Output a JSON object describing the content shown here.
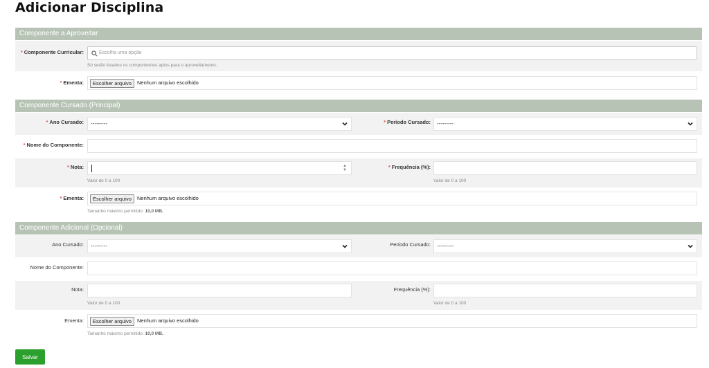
{
  "page": {
    "title": "Adicionar Disciplina",
    "save_label": "Salvar"
  },
  "colors": {
    "section_header": "#b7c4b5",
    "required": "#d9534f",
    "save_button": "#2ca02c"
  },
  "section1": {
    "title": "Componente a Aproveitar",
    "componente_label": "Componente Curricular:",
    "componente_placeholder": "Escolha uma opção",
    "componente_help": "Só serão listados os compontentes aptos para o aproveitamento.",
    "ementa_label": "Ementa:",
    "file_button": "Escolher arquivo",
    "file_status": "Nenhum arquivo escolhido"
  },
  "section2": {
    "title": "Componente Cursado (Principal)",
    "ano_label": "Ano Cursado:",
    "ano_value": "---------",
    "periodo_label": "Período Cursado:",
    "periodo_value": "---------",
    "nome_label": "Nome do Componente:",
    "nota_label": "Nota:",
    "nota_help": "Valor de 0 a 100",
    "freq_label": "Frequência (%):",
    "freq_help": "Valor de 0 a 100",
    "ementa_label": "Ementa:",
    "file_button": "Escolher arquivo",
    "file_status": "Nenhum arquivo escolhido",
    "size_help_prefix": "Tamanho máximo permitido:",
    "size_help_value": "10,0 MB."
  },
  "section3": {
    "title": "Componente Adicional (Opcional)",
    "ano_label": "Ano Cursado:",
    "ano_value": "---------",
    "periodo_label": "Período Cursado:",
    "periodo_value": "---------",
    "nome_label": "Nome do Componente:",
    "nota_label": "Nota:",
    "nota_help": "Valor de 0 a 100",
    "freq_label": "Frequência (%):",
    "freq_help": "Valor de 0 a 100",
    "ementa_label": "Ementa:",
    "file_button": "Escolher arquivo",
    "file_status": "Nenhum arquivo escolhido",
    "size_help_prefix": "Tamanho máximo permitido:",
    "size_help_value": "10,0 MB."
  }
}
